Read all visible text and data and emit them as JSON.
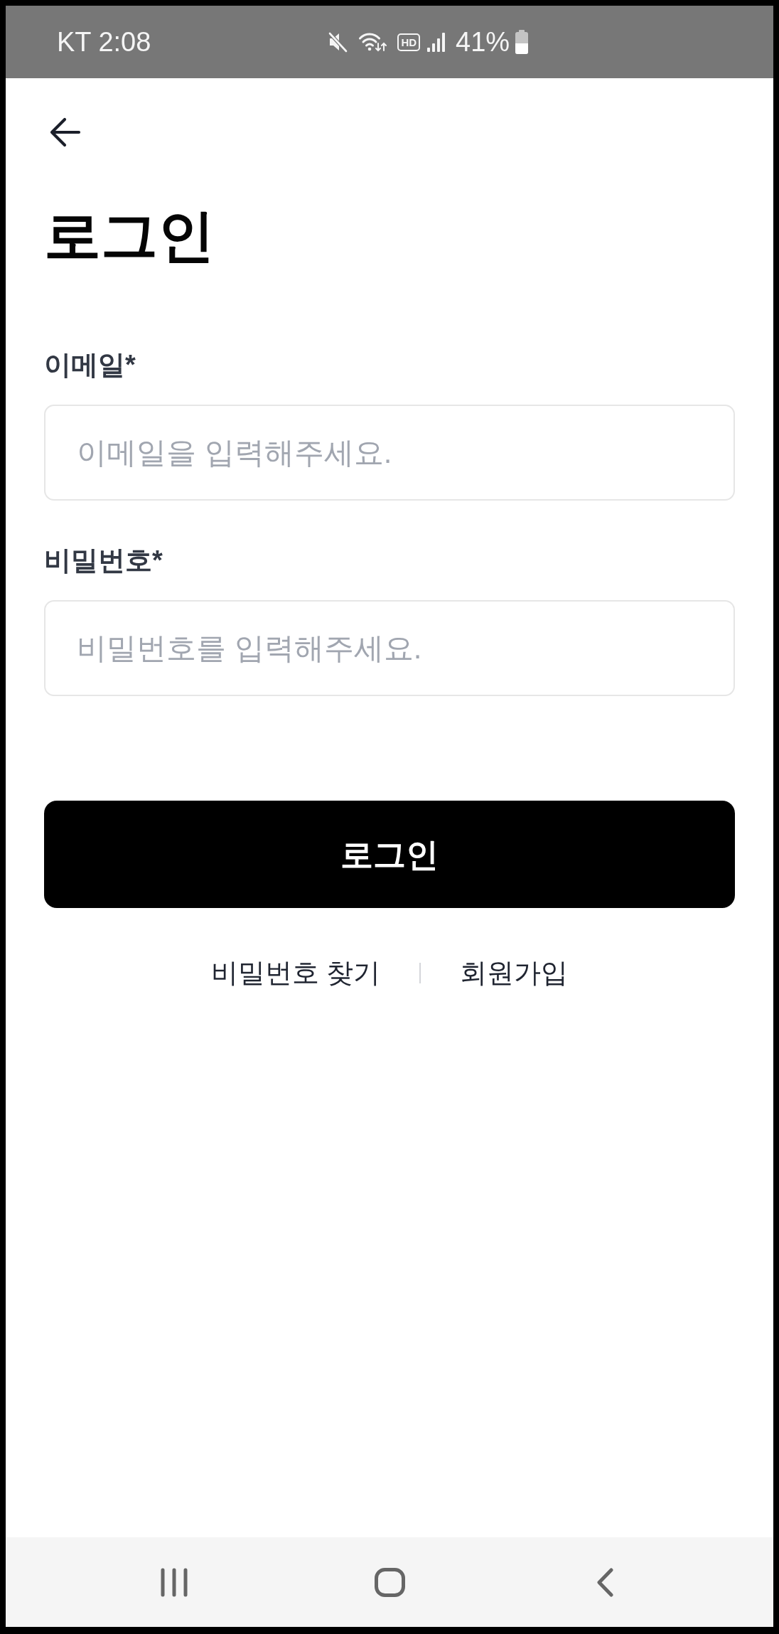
{
  "status_bar": {
    "carrier_time": "KT 2:08",
    "hd_indicator": "HD",
    "battery_percent": "41%"
  },
  "header": {
    "title": "로그인"
  },
  "form": {
    "fields": [
      {
        "label": "이메일*",
        "placeholder": "이메일을 입력해주세요."
      },
      {
        "label": "비밀번호*",
        "placeholder": "비밀번호를 입력해주세요."
      }
    ],
    "submit_button": "로그인"
  },
  "links": [
    "비밀번호 찾기",
    "회원가입"
  ]
}
